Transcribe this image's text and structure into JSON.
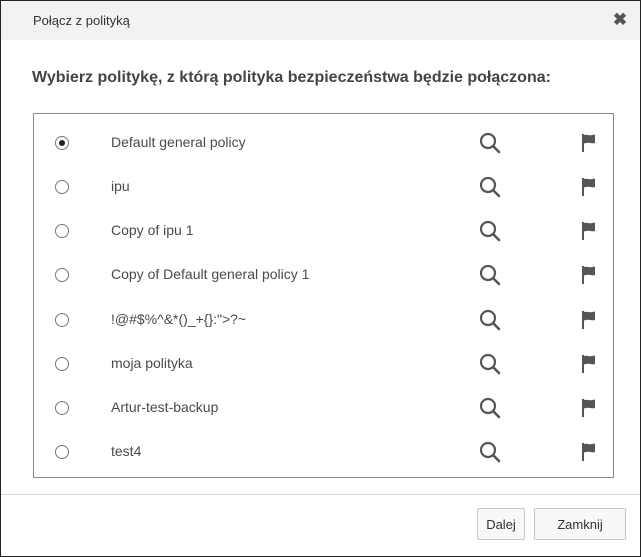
{
  "dialog": {
    "title": "Połącz z polityką",
    "close_glyph": "✖",
    "close_icon": "close-icon",
    "heading": "Wybierz politykę, z którą polityka bezpieczeństwa będzie połączona:"
  },
  "policies": [
    {
      "label": "Default general policy",
      "selected": true
    },
    {
      "label": "ipu",
      "selected": false
    },
    {
      "label": "Copy of ipu 1",
      "selected": false
    },
    {
      "label": "Copy of Default general policy 1",
      "selected": false
    },
    {
      "label": "!@#$%^&*()_+{}:\">?~",
      "selected": false
    },
    {
      "label": "moja polityka",
      "selected": false
    },
    {
      "label": "Artur-test-backup",
      "selected": false
    },
    {
      "label": "test4",
      "selected": false
    }
  ],
  "row_icons": {
    "preview": "search-icon",
    "flag": "flag-icon"
  },
  "colors": {
    "titlebar_bg": "#f2f2f2",
    "text": "#4a4a4a",
    "icon": "#555555"
  },
  "footer": {
    "next_label": "Dalej",
    "close_label": "Zamknij"
  }
}
